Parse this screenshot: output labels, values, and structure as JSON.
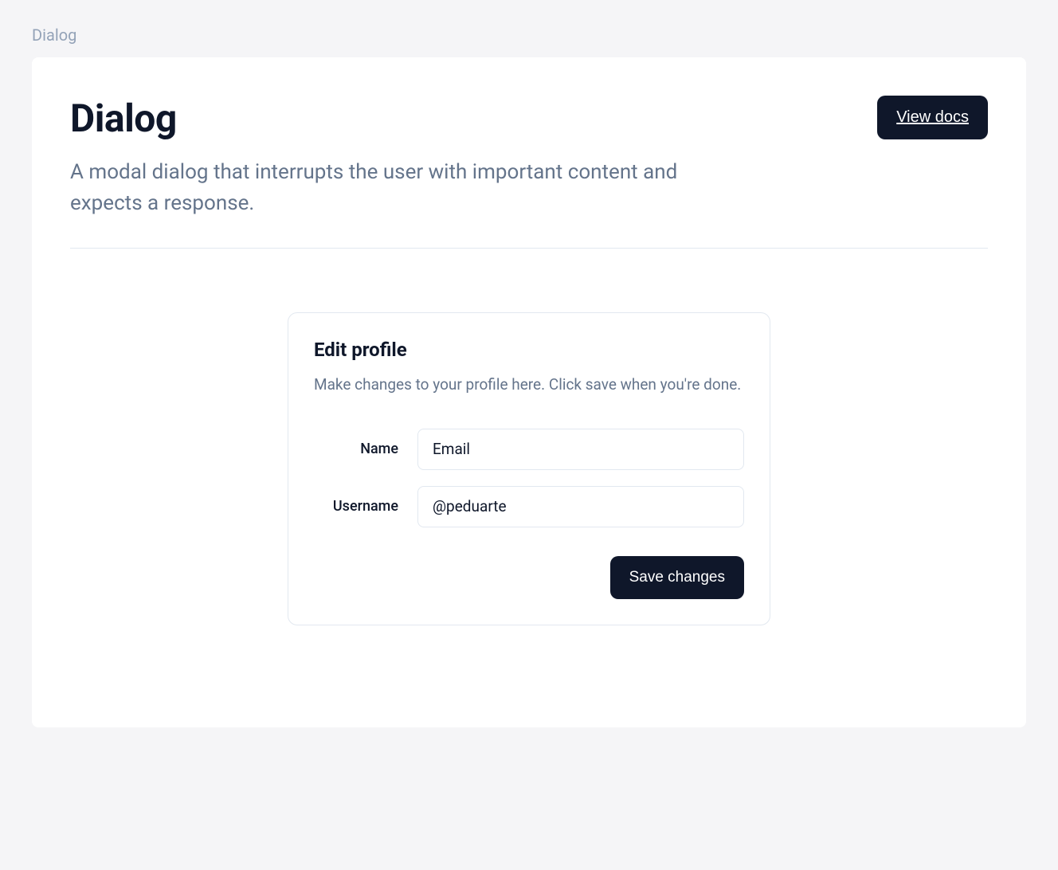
{
  "breadcrumb": "Dialog",
  "header": {
    "title": "Dialog",
    "description": "A modal dialog that interrupts the user with important content and expects a response.",
    "view_docs_label": "View docs"
  },
  "dialog": {
    "title": "Edit profile",
    "description": "Make changes to your profile here. Click save when you're done.",
    "fields": [
      {
        "label": "Name",
        "value": "Email"
      },
      {
        "label": "Username",
        "value": "@peduarte"
      }
    ],
    "save_label": "Save changes"
  }
}
